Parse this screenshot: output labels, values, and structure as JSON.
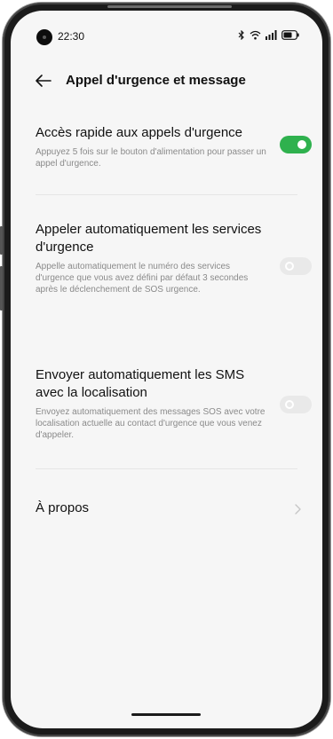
{
  "status_bar": {
    "time": "22:30",
    "icons": [
      "bluetooth-icon",
      "wifi-icon",
      "signal-icon",
      "battery-icon"
    ]
  },
  "header": {
    "back_icon": "arrow-left-icon",
    "title": "Appel d'urgence et message"
  },
  "settings": [
    {
      "title": "Accès rapide aux appels d'urgence",
      "description": "Appuyez 5 fois sur le bouton d'alimentation pour passer un appel d'urgence.",
      "enabled": true
    },
    {
      "title": "Appeler automatiquement les services d'urgence",
      "description": "Appelle automatiquement le numéro des services d'urgence que vous avez défini par défaut 3 secondes après le déclenchement de SOS urgence.",
      "enabled": false
    },
    {
      "title": "Envoyer automatiquement les SMS avec la localisation",
      "description": "Envoyez automatiquement des messages SOS avec votre localisation actuelle au contact d'urgence que vous venez d'appeler.",
      "enabled": false
    }
  ],
  "about": {
    "label": "À propos",
    "icon": "chevron-right-icon"
  },
  "colors": {
    "toggle_on": "#2fb14e",
    "toggle_off": "#e9e9e9",
    "background": "#f6f6f6"
  }
}
